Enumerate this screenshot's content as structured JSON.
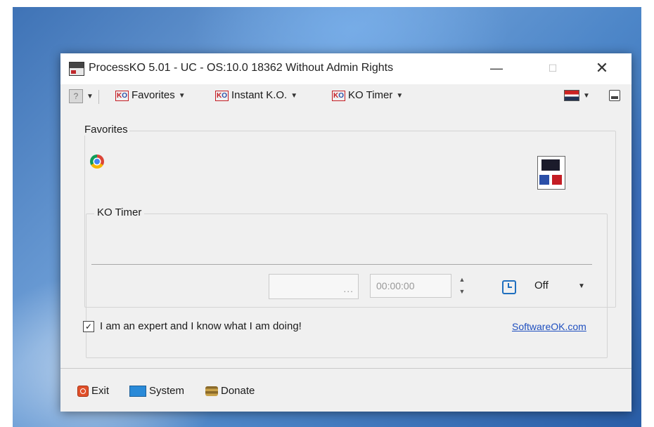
{
  "window": {
    "title": "ProcessKO 5.01 - UC  - OS:10.0 18362 Without Admin Rights",
    "minimize": "—",
    "maximize": "☐",
    "close": "✕"
  },
  "toolbar": {
    "favorites": "Favorites",
    "instant_ko": "Instant K.O.",
    "ko_timer": "KO Timer",
    "caret": "▼",
    "help_icon": "?"
  },
  "favorites_group": {
    "label": "Favorites",
    "items": [
      "chrome-icon"
    ]
  },
  "timer_group": {
    "label": "KO Timer",
    "field_dots": "...",
    "time_value": "00:00:00",
    "spin_up": "▲",
    "spin_down": "▼",
    "mode": "Off",
    "mode_caret": "▼"
  },
  "expert_checkbox": {
    "checked_mark": "✓",
    "label": "I am an expert and I know what I am doing!"
  },
  "link": "SoftwareOK.com",
  "bottom": {
    "exit": "Exit",
    "system": "System",
    "donate": "Donate"
  },
  "colors": {
    "accent_red": "#c41d24",
    "accent_blue": "#2b4fa8",
    "link_blue": "#1f4fbf"
  }
}
